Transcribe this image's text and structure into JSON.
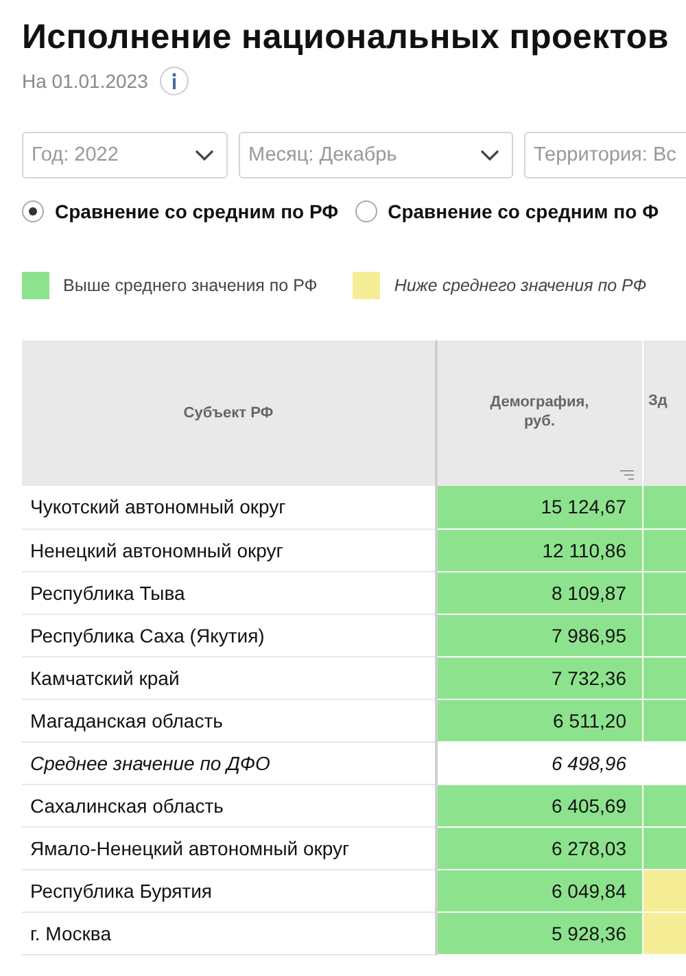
{
  "title": "Исполнение национальных проектов",
  "date": "На 01.01.2023",
  "filters": [
    {
      "label": "Год: 2022"
    },
    {
      "label": "Месяц: Декабрь"
    },
    {
      "label": "Территория: Вс"
    }
  ],
  "comparison": [
    {
      "label": "Сравнение со средним по РФ",
      "selected": true
    },
    {
      "label": "Сравнение со средним по Ф",
      "selected": false
    }
  ],
  "legend": [
    {
      "label": "Выше среднего значения по РФ",
      "color": "#8de38d"
    },
    {
      "label": "Ниже среднего значения по РФ",
      "color": "#f6ed97"
    }
  ],
  "table": {
    "columns": [
      "Субъект РФ",
      "Демография, руб.",
      "Зд"
    ],
    "rows": [
      {
        "kind": "region",
        "name": "Чукотский автономный округ",
        "cells": [
          {
            "value": "15 124,67",
            "color": "#8de38d"
          },
          {
            "color": "#8de38d"
          }
        ]
      },
      {
        "kind": "region",
        "name": "Ненецкий автономный округ",
        "cells": [
          {
            "value": "12 110,86",
            "color": "#8de38d"
          },
          {
            "color": "#8de38d"
          }
        ]
      },
      {
        "kind": "region",
        "name": "Республика Тыва",
        "cells": [
          {
            "value": "8 109,87",
            "color": "#8de38d"
          },
          {
            "color": "#8de38d"
          }
        ]
      },
      {
        "kind": "region",
        "name": "Республика Саха (Якутия)",
        "cells": [
          {
            "value": "7 986,95",
            "color": "#8de38d"
          },
          {
            "color": "#8de38d"
          }
        ]
      },
      {
        "kind": "region",
        "name": "Камчатский край",
        "cells": [
          {
            "value": "7 732,36",
            "color": "#8de38d"
          },
          {
            "color": "#8de38d"
          }
        ]
      },
      {
        "kind": "region",
        "name": "Магаданская область",
        "cells": [
          {
            "value": "6 511,20",
            "color": "#8de38d"
          },
          {
            "color": "#8de38d"
          }
        ]
      },
      {
        "kind": "average",
        "name": "Среднее значение по ДФО",
        "cells": [
          {
            "value": "6 498,96",
            "color": "#ffffff"
          },
          {
            "color": "#ffffff"
          }
        ]
      },
      {
        "kind": "region",
        "name": "Сахалинская область",
        "cells": [
          {
            "value": "6 405,69",
            "color": "#8de38d"
          },
          {
            "color": "#8de38d"
          }
        ]
      },
      {
        "kind": "region",
        "name": "Ямало-Ненецкий автономный округ",
        "cells": [
          {
            "value": "6 278,03",
            "color": "#8de38d"
          },
          {
            "color": "#8de38d"
          }
        ]
      },
      {
        "kind": "region",
        "name": "Республика Бурятия",
        "cells": [
          {
            "value": "6 049,84",
            "color": "#8de38d"
          },
          {
            "color": "#f6ed97"
          }
        ]
      },
      {
        "kind": "region",
        "name": "г. Москва",
        "cells": [
          {
            "value": "5 928,36",
            "color": "#8de38d"
          },
          {
            "color": "#f6ed97"
          }
        ]
      }
    ]
  }
}
